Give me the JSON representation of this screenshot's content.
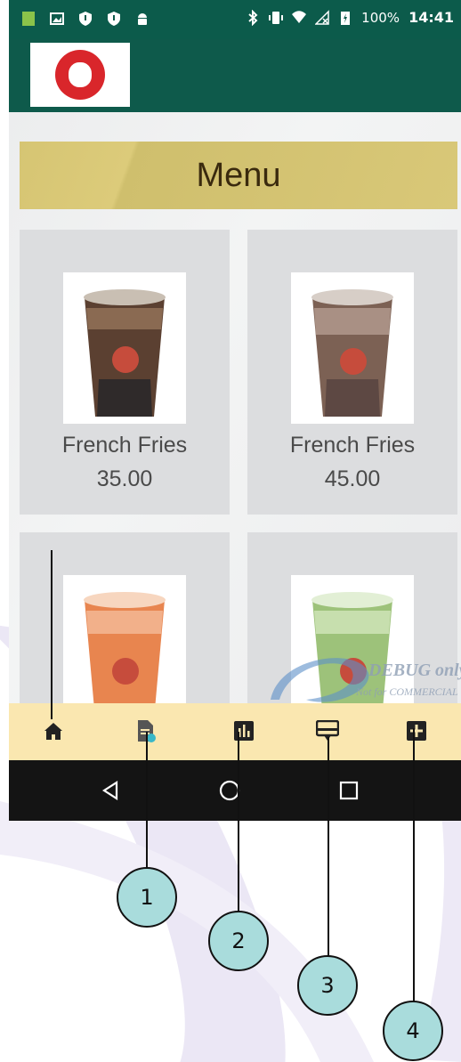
{
  "status_bar": {
    "battery_percent": "100%",
    "time": "14:41"
  },
  "app_bar": {
    "logo_icon": "grand-coffee-boy-logo"
  },
  "menu": {
    "title": "Menu",
    "items": [
      {
        "name": "French Fries",
        "price": "35.00",
        "drink_color": "#6b4a34"
      },
      {
        "name": "French Fries",
        "price": "45.00",
        "drink_color": "#8a6c5a"
      },
      {
        "name": "",
        "price": "",
        "drink_color": "#e48a5c"
      },
      {
        "name": "",
        "price": "",
        "drink_color": "#a7c788"
      }
    ]
  },
  "watermark": {
    "text": "DEBUG only",
    "subtext": "Not for COMMERCIAL"
  },
  "bottom_nav": {
    "items": [
      {
        "icon": "home-icon"
      },
      {
        "icon": "document-sync-icon"
      },
      {
        "icon": "report-chart-icon"
      },
      {
        "icon": "display-screen-icon"
      },
      {
        "icon": "add-square-icon"
      }
    ]
  },
  "system_nav": {
    "items": [
      {
        "icon": "back-icon"
      },
      {
        "icon": "home-circle-icon"
      },
      {
        "icon": "recent-apps-icon"
      }
    ]
  },
  "callouts": {
    "c1": "1",
    "c2": "2",
    "c3": "3",
    "c4": "4"
  },
  "colors": {
    "status_bar": "#0c5b4b",
    "bottom_nav": "#fae7b0",
    "menu_banner": "#d6c573",
    "callout": "#a9dcdc"
  }
}
